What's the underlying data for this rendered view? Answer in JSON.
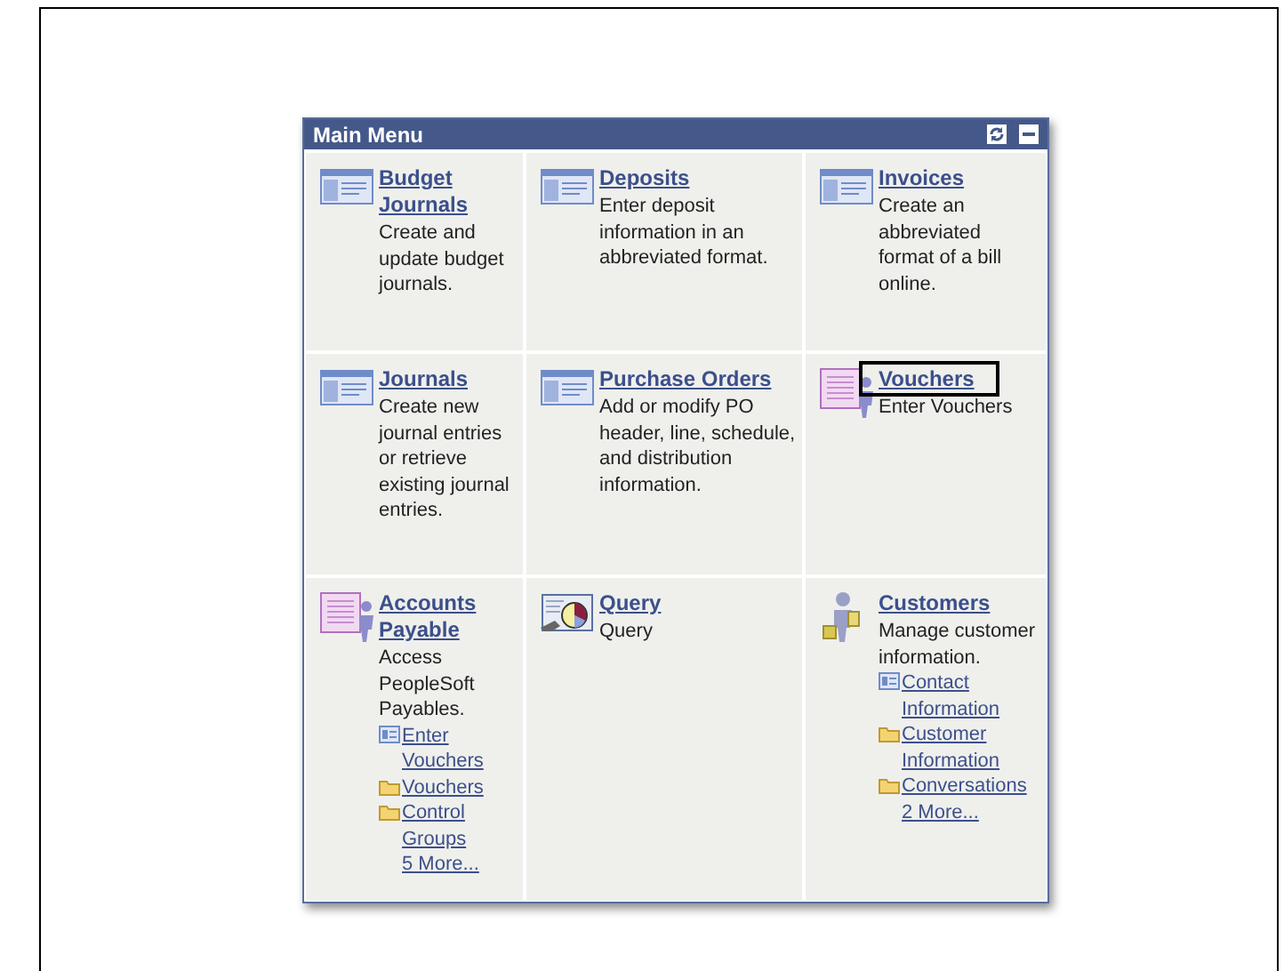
{
  "panel": {
    "title": "Main Menu",
    "items": [
      {
        "kind": "page",
        "title": "Budget Journals",
        "description": "Create and update budget journals.",
        "highlighted": false
      },
      {
        "kind": "page",
        "title": "Deposits",
        "description": "Enter deposit information in an abbreviated format.",
        "highlighted": false
      },
      {
        "kind": "page",
        "title": "Invoices",
        "description": "Create an abbreviated format of a bill online.",
        "highlighted": false
      },
      {
        "kind": "page",
        "title": "Journals",
        "description": "Create new journal entries or retrieve existing journal entries.",
        "highlighted": false
      },
      {
        "kind": "page",
        "title": "Purchase Orders",
        "description": "Add or modify PO header, line, schedule, and distribution information.",
        "highlighted": false
      },
      {
        "kind": "register",
        "title": "Vouchers",
        "description": "Enter Vouchers",
        "highlighted": true
      },
      {
        "kind": "register",
        "title": "Accounts Payable",
        "description": "Access PeopleSoft Payables.",
        "highlighted": false,
        "links": [
          {
            "kind": "page",
            "label": "Enter Vouchers"
          },
          {
            "kind": "folder",
            "label": "Vouchers"
          },
          {
            "kind": "folder",
            "label": "Control Groups"
          }
        ],
        "more": "5 More..."
      },
      {
        "kind": "query",
        "title": "Query",
        "description": "Query",
        "highlighted": false
      },
      {
        "kind": "person",
        "title": "Customers",
        "description": "Manage customer information.",
        "highlighted": false,
        "links": [
          {
            "kind": "page",
            "label": "Contact Information"
          },
          {
            "kind": "folder",
            "label": "Customer Information"
          },
          {
            "kind": "folder",
            "label": "Conversations"
          }
        ],
        "more": "2 More..."
      }
    ]
  }
}
